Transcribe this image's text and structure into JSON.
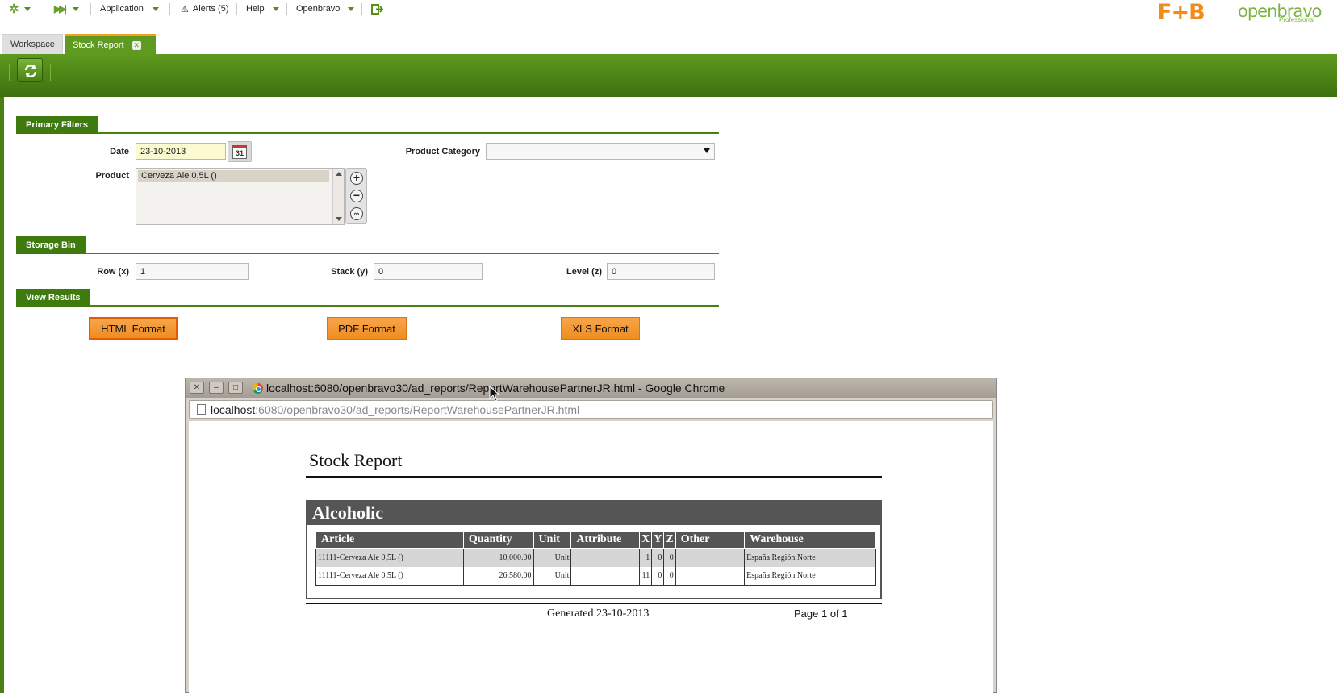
{
  "topnav": {
    "application_label": "Application",
    "alerts_label": "Alerts (5)",
    "help_label": "Help",
    "user_label": "Openbravo"
  },
  "brand": {
    "fb_logo_text": "F+B",
    "ob_logo_text": "openbravo",
    "ob_edition": "Professional",
    "accent_green": "#5d9a1f",
    "accent_orange": "#f5a025"
  },
  "tabs": [
    {
      "label": "Workspace",
      "active": false
    },
    {
      "label": "Stock Report",
      "active": true
    }
  ],
  "filters": {
    "primary_title": "Primary Filters",
    "date_label": "Date",
    "date_value": "23-10-2013",
    "product_category_label": "Product Category",
    "product_category_value": "",
    "product_label": "Product",
    "product_selected": "Cerveza Ale 0,5L ()",
    "storage_title": "Storage Bin",
    "row_label": "Row (x)",
    "row_value": "1",
    "stack_label": "Stack (y)",
    "stack_value": "0",
    "level_label": "Level (z)",
    "level_value": "0",
    "view_title": "View Results",
    "html_button": "HTML Format",
    "pdf_button": "PDF Format",
    "xls_button": "XLS Format"
  },
  "popup": {
    "window_title": "localhost:6080/openbravo30/ad_reports/ReportWarehousePartnerJR.html - Google Chrome",
    "url_host": "localhost",
    "url_path": ":6080/openbravo30/ad_reports/ReportWarehousePartnerJR.html",
    "report": {
      "title": "Stock Report",
      "category": "Alcoholic",
      "columns": [
        "Article",
        "Quantity",
        "Unit",
        "Attribute",
        "X",
        "Y",
        "Z",
        "Other",
        "Warehouse"
      ],
      "rows": [
        [
          "11111-Cerveza Ale 0,5L ()",
          "10,000.00",
          "Unit",
          "",
          "1",
          "0",
          "0",
          "",
          "España Región Norte"
        ],
        [
          "11111-Cerveza Ale 0,5L ()",
          "26,580.00",
          "Unit",
          "",
          "11",
          "0",
          "0",
          "",
          "España Región Norte"
        ]
      ],
      "generated": "Generated 23-10-2013",
      "page_info": "Page 1 of 1"
    }
  }
}
